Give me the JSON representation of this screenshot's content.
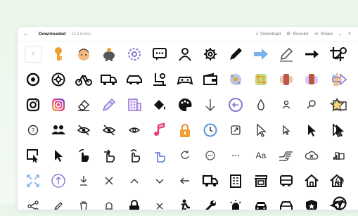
{
  "toolbar": {
    "title": "Downloaded",
    "count": "113 icons",
    "download_label": "Download",
    "recolor_label": "Recolor",
    "share_label": "Share",
    "back_glyph": "←",
    "add_glyph": "+"
  },
  "icons": {
    "row1": [
      "key-icon",
      "face-icon",
      "piggy-bank-icon",
      "settings-dots-icon",
      "chat-dots-icon",
      "person-icon",
      "gear-icon",
      "pen-icon",
      "arrow-right-icon",
      "pencil-icon",
      "arrow-right-bold-icon",
      "crop-icon",
      "key-chain-icon"
    ],
    "row2": [
      "settings-circle-icon",
      "settings-round-icon",
      "bicycle-icon",
      "truck-icon",
      "car-icon",
      "seat-icon",
      "game-controller-icon",
      "wallet-icon",
      "gear-color-icon",
      "crop-color-icon",
      "hourglass-color-icon",
      "lunchbox-color-icon",
      "hand-color-icon",
      "arrow-right-color-icon"
    ],
    "row3": [
      "instagram-icon",
      "instagram-color-icon",
      "eraser-icon",
      "pen-color-icon",
      "building-color-icon",
      "paint-bucket-icon",
      "palette-icon",
      "arrow-down-icon",
      "back-circle-icon",
      "water-drop-icon",
      "person-small-icon",
      "search-icon",
      "star-color-icon",
      "folder-icon"
    ],
    "row4": [
      "help-circle-icon",
      "group-icon",
      "eye-off-icon",
      "eye-off-icon",
      "eye-icon",
      "music-note-icon",
      "lock-color-icon",
      "clock-color-icon",
      "share-box-icon",
      "cursor-icon",
      "cursor-small-icon",
      "cursor-bold-icon",
      "cursor-outline-icon",
      "cursor-fill-icon"
    ],
    "row5": [
      "cursor-box-icon",
      "cursor-icon",
      "hand-touch-icon",
      "hand-swipe-icon",
      "hand-tap-icon",
      "hand-tap-color-icon",
      "refresh-icon",
      "more-circle-icon",
      "more-icon",
      "text-icon",
      "hand-point-icon",
      "cloud-off-icon",
      "signal-icon",
      "folder-small-icon"
    ],
    "row6": [
      "expand-color-icon",
      "upload-circle-icon",
      "download-icon",
      "close-icon",
      "chevron-up-icon",
      "chevron-down-icon",
      "arrow-left-icon",
      "truck-bold-icon",
      "building-icon",
      "store-icon",
      "bus-icon",
      "home-icon",
      "home-outline-icon",
      "film-reel-icon"
    ],
    "row7": [
      "share-icon",
      "pencil-small-icon",
      "trash-icon",
      "bell-icon",
      "lock-icon",
      "close-small-icon",
      "worker-icon",
      "wrench-icon",
      "siren-icon",
      "car-front-icon",
      "car-outline-icon",
      "shield-icon",
      "navigation-icon",
      "steering-wheel-icon"
    ]
  },
  "colors": {
    "ink": "#111111",
    "grey": "#555555",
    "accent_blue": "#6ea8e8",
    "orange": "#f0a030",
    "pink": "#e8427a",
    "purple": "#8a78d0"
  }
}
